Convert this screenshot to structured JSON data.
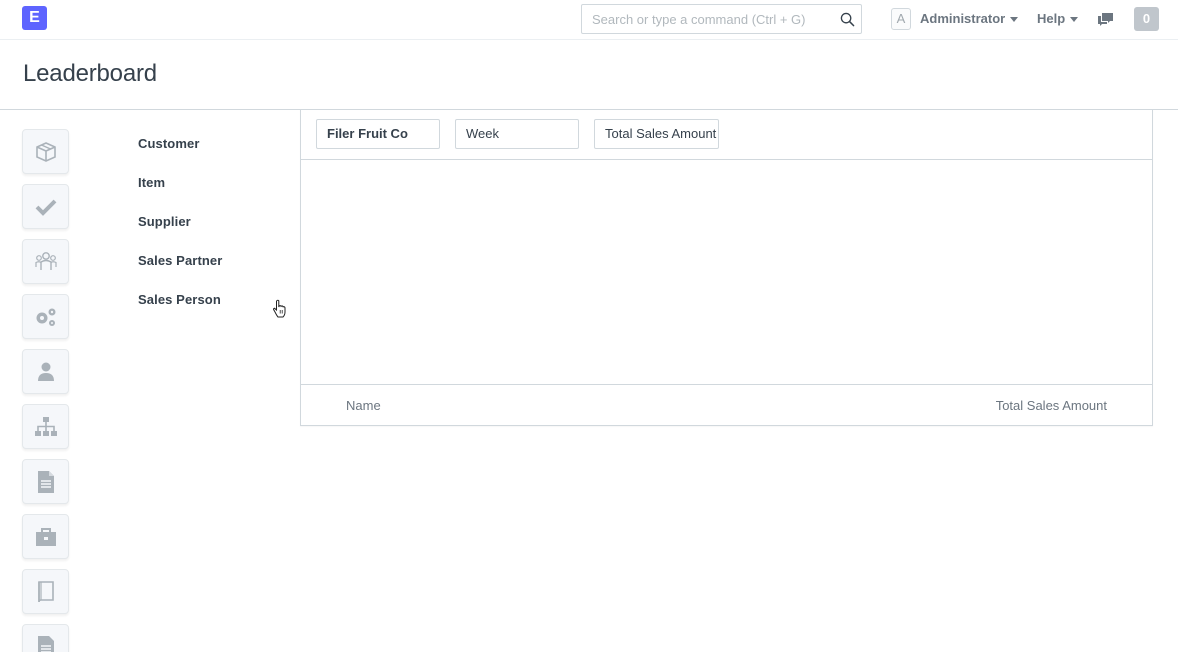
{
  "navbar": {
    "logo_letter": "E",
    "search_placeholder": "Search or type a command (Ctrl + G)",
    "avatar_letter": "A",
    "user_name": "Administrator",
    "help_label": "Help",
    "notifications_count": "0"
  },
  "page": {
    "title": "Leaderboard"
  },
  "sidebar": {
    "icon_cards": [
      "box-icon",
      "check-icon",
      "users-icon",
      "gears-icon",
      "user-icon",
      "sitemap-icon",
      "file-icon",
      "briefcase-icon",
      "book-icon",
      "file-text-icon"
    ],
    "types": [
      "Customer",
      "Item",
      "Supplier",
      "Sales Partner",
      "Sales Person"
    ]
  },
  "filters": {
    "company": "Filer Fruit Co",
    "period": "Week",
    "field": "Total Sales Amount"
  },
  "table": {
    "columns": [
      "Name",
      "Total Sales Amount"
    ]
  },
  "colors": {
    "brand": "#5e64ff",
    "text": "#36414c",
    "muted": "#6c7680",
    "border": "#d1d8dd",
    "icon_grey": "#aab2b9"
  }
}
